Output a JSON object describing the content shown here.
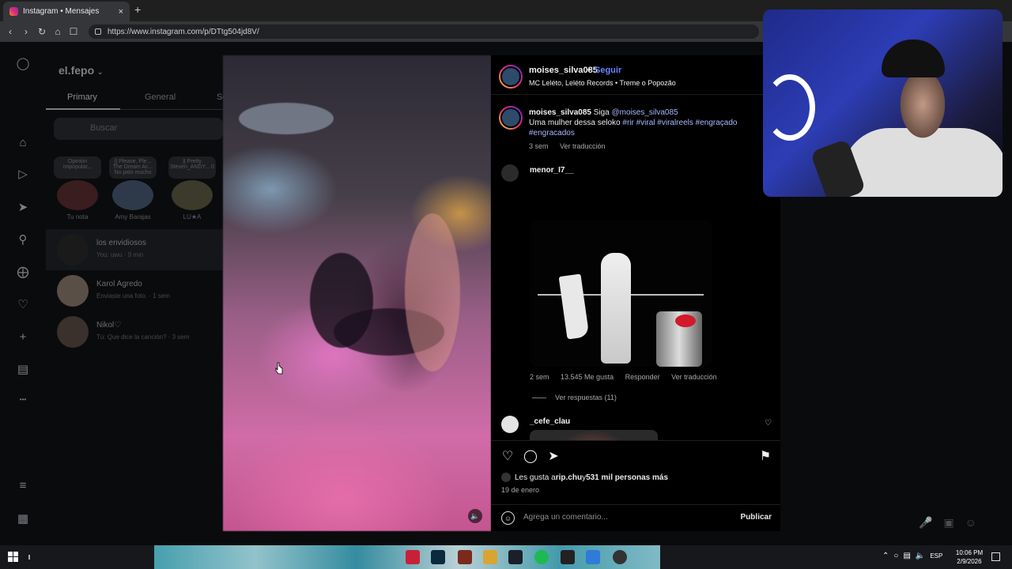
{
  "browser": {
    "tab_title": "Instagram • Mensajes",
    "tab_close": "×",
    "new_tab": "+",
    "url": "https://www.instagram.com/p/DTtg504jd8V/"
  },
  "dm": {
    "username": "el.fepo",
    "tabs": [
      "Primary",
      "General",
      "Sc"
    ],
    "search_placeholder": "Buscar",
    "notes": [
      {
        "bubble": "Opinión impopular...",
        "name": "Tu nota"
      },
      {
        "bubble": "|| Please, Ple... The Dream Ac... No pido mucho",
        "name": "Amy Barajas"
      },
      {
        "bubble": "|| Pretty Steven_ANDY... 0",
        "name": "LU★A"
      }
    ],
    "chats": [
      {
        "name": "los envidiosos",
        "msg": "You: uwu · 9 min"
      },
      {
        "name": "Karol Agredo",
        "msg": "Enviaste una foto. · 1 sem"
      },
      {
        "name": "Nikol♡",
        "msg": "Tú: Que dice la canción? · 3 sem"
      }
    ]
  },
  "post": {
    "author": "moises_silva085",
    "dot": "•",
    "follow": "Seguir",
    "audio": "MC Leléto, Leléto Records • Treme o Popozão",
    "caption_author": "moises_silva085",
    "caption_pre": " Siga ",
    "caption_mention": "@moises_silva085",
    "caption_text": "Uma mulher dessa seloko ",
    "caption_tags": "#rir #viral #viralreels #engraçado #engracados",
    "caption_age": "3 sem",
    "caption_translate": "Ver traducción",
    "comment1": {
      "author": "menor_I7__",
      "age": "2 sem",
      "likes": "13.545 Me gusta",
      "reply": "Responder",
      "translate": "Ver traducción",
      "view_replies": "Ver respuestas (11)"
    },
    "comment2": {
      "author": "_cefe_clau"
    },
    "likes_pre": "Les gusta a ",
    "likes_user": "rip.chu",
    "likes_mid": " y ",
    "likes_count": "531 mil personas más",
    "date": "19 de enero",
    "comment_placeholder": "Agrega un comentario...",
    "publish": "Publicar"
  },
  "taskbar": {
    "lang": "ESP",
    "time": "10:06 PM",
    "date": "2/9/2026"
  },
  "colors": {
    "accent_link": "#6c83ff",
    "hashtag": "#a9b6ff",
    "background": "#000000"
  },
  "icons": [
    "instagram-icon",
    "home-icon",
    "reels-icon",
    "messages-icon",
    "search-icon",
    "explore-icon",
    "heart-icon",
    "create-icon",
    "dashboard-icon",
    "menu-icon",
    "more-icon",
    "comment-icon",
    "share-icon",
    "bookmark-icon",
    "mute-icon",
    "emoji-icon",
    "mic-icon",
    "image-icon",
    "sticker-icon"
  ]
}
